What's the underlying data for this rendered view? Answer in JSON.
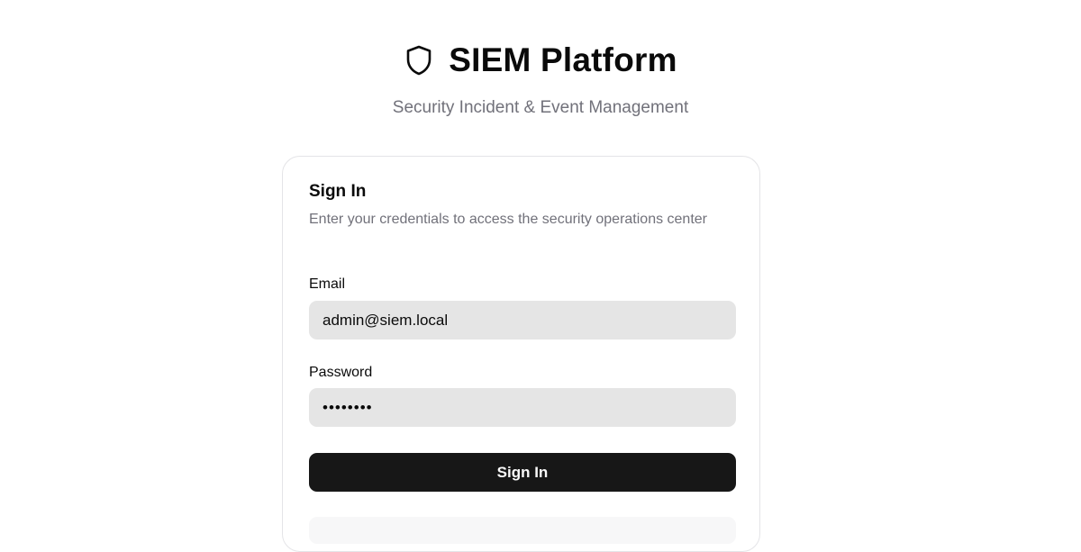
{
  "header": {
    "icon": "shield-icon",
    "title": "SIEM Platform",
    "subtitle": "Security Incident & Event Management"
  },
  "card": {
    "title": "Sign In",
    "description": "Enter your credentials to access the security operations center",
    "email": {
      "label": "Email",
      "value": "admin@siem.local"
    },
    "password": {
      "label": "Password",
      "value": "••••••••"
    },
    "submit_label": "Sign In"
  },
  "colors": {
    "primary_button": "#171717",
    "input_background": "#e5e5e5",
    "muted_text": "#71717a"
  }
}
